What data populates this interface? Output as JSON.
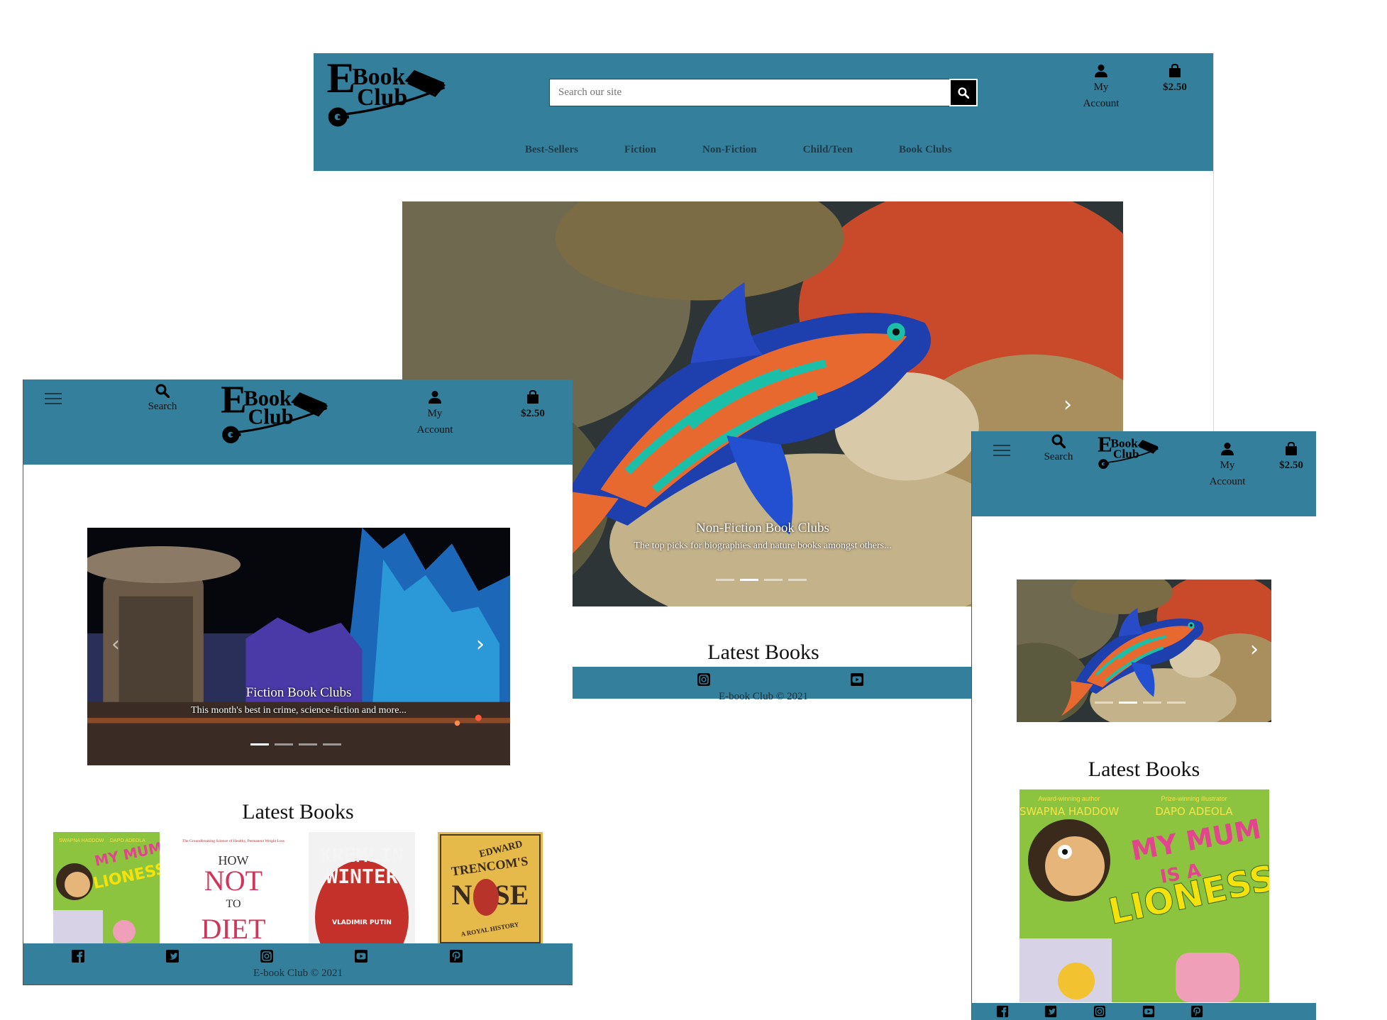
{
  "site": {
    "search_placeholder": "Search our site",
    "search_label": "Search",
    "account_label_line1": "My",
    "account_label_line2": "Account",
    "cart_total": "$2.50",
    "copyright": "E-book Club © 2021",
    "brand_color": "#337f9c",
    "logo_word_top": "Book",
    "logo_word_bottom": "Club",
    "logo_initial": "E"
  },
  "main_nav": [
    "Best-Sellers",
    "Fiction",
    "Non-Fiction",
    "Child/Teen",
    "Book Clubs"
  ],
  "carousel": {
    "slides": [
      {
        "title": "Fiction Book Clubs",
        "text": "This month's best in crime, science-fiction and more..."
      },
      {
        "title": "Non-Fiction Book Clubs",
        "text": "The top picks for biographies and nature books amongst others..."
      }
    ]
  },
  "latest_books": {
    "title": "Latest Books",
    "books": [
      {
        "title": "MY MUM IS A LIONESS",
        "author": "SWAPNA HADDOW",
        "illustrator": "DAPO ADEOLA",
        "author_note": "Award-winning author",
        "illustrator_note": "Prize-winning illustrator"
      },
      {
        "title": "HOW NOT TO DIET",
        "subtitle": "The Groundbreaking Science of Healthy, Permanent Weight Loss"
      },
      {
        "title": "KREMLIN WINTER",
        "subtitle": "VLADIMIR PUTIN"
      },
      {
        "title": "TRENCOM'S NOSE",
        "author": "EDWARD",
        "subtitle": "A ROYAL HISTORY"
      }
    ]
  },
  "social_icons": [
    "facebook-icon",
    "twitter-icon",
    "instagram-icon",
    "youtube-icon",
    "pinterest-icon"
  ]
}
